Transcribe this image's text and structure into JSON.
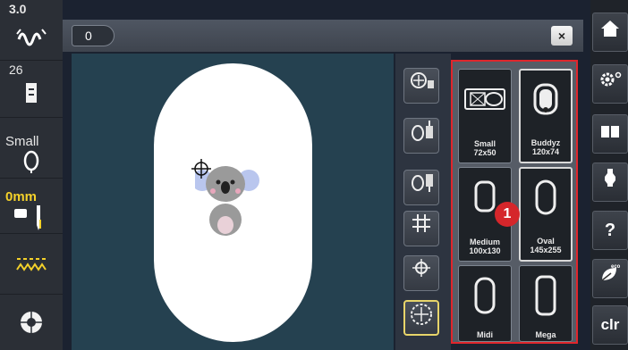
{
  "left_sidebar": {
    "stitch_width": "3.0",
    "stitch_number": "26",
    "presser_size": "Small",
    "needle_position": "0mm"
  },
  "top_bar": {
    "frame_indicator": "0",
    "close_label": "×"
  },
  "tools": [
    {
      "icon": "move-to-center-icon"
    },
    {
      "icon": "upper-thread-icon"
    },
    {
      "icon": "bobbin-thread-icon"
    },
    {
      "icon": "grid-icon"
    },
    {
      "icon": "crosshair-icon"
    },
    {
      "icon": "hoop-center-icon"
    }
  ],
  "hoops": [
    {
      "name": "Small",
      "size": "72x50"
    },
    {
      "name": "Buddyz",
      "size": "120x74"
    },
    {
      "name": "Medium",
      "size": "100x130"
    },
    {
      "name": "Oval",
      "size": "145x255"
    },
    {
      "name": "Midi",
      "size": ""
    },
    {
      "name": "Mega",
      "size": ""
    }
  ],
  "callout": "1",
  "right_sidebar": {
    "clr_label": "clr",
    "help_label": "?"
  },
  "colors": {
    "callout": "#d5262b",
    "highlight_border": "#e0262c",
    "needle_value": "#f4d12a"
  }
}
